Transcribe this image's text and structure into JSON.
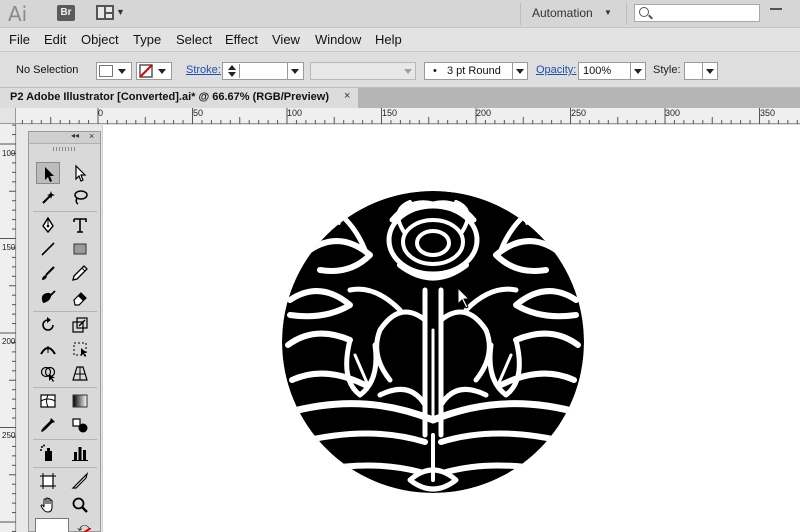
{
  "app": {
    "logo": "Ai",
    "bridge": "Br",
    "workspace": "Automation",
    "search_placeholder": ""
  },
  "menu": [
    "File",
    "Edit",
    "Object",
    "Type",
    "Select",
    "Effect",
    "View",
    "Window",
    "Help"
  ],
  "control": {
    "selection": "No Selection",
    "stroke_label": "Stroke:",
    "stroke_weight": "",
    "brush": "",
    "profile_bullet": "•",
    "profile": "3 pt Round",
    "opacity_label": "Opacity:",
    "opacity": "100%",
    "style_label": "Style:"
  },
  "document": {
    "tab_title": "P2 Adobe Illustrator [Converted].ai* @ 66.67% (RGB/Preview)",
    "close": "×"
  },
  "rulers": {
    "h_labels": [
      "0",
      "50",
      "100",
      "150",
      "200",
      "250",
      "300",
      "350"
    ],
    "v_labels": [
      "100",
      "150",
      "200",
      "250"
    ]
  },
  "tools_panel": {
    "collapse": "◂◂",
    "close": "×"
  },
  "colors": {
    "chrome": "#d6d6d6",
    "link": "#1f4fb0",
    "artwork": "#000000"
  }
}
